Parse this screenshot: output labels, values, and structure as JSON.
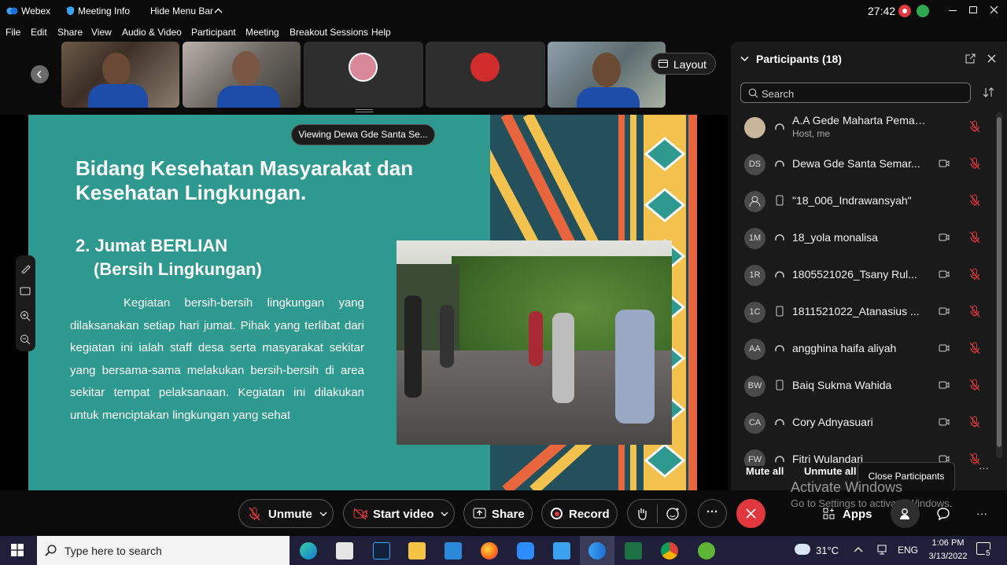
{
  "titlebar": {
    "app_name": "Webex",
    "meeting_info": "Meeting Info",
    "hide_menu": "Hide Menu Bar",
    "timer": "27:42"
  },
  "menu": [
    "File",
    "Edit",
    "Share",
    "View",
    "Audio & Video",
    "Participant",
    "Meeting",
    "Breakout Sessions",
    "Help"
  ],
  "layout_button": "Layout",
  "viewing_label": "Viewing Dewa Gde Santa Se...",
  "slide": {
    "title": "Bidang Kesehatan Masyarakat dan Kesehatan Lingkungan.",
    "subtitle_line1": "2. Jumat BERLIAN",
    "subtitle_line2": "(Bersih Lingkungan)",
    "body": "Kegiatan bersih-bersih lingkungan yang dilaksanakan setiap hari jumat. Pihak yang terlibat dari kegiatan ini ialah staff desa serta masyarakat sekitar yang bersama-sama melakukan bersih-bersih di area sekitar tempat pelaksanaan. Kegiatan ini dilakukan untuk menciptakan lingkungan yang sehat"
  },
  "participants": {
    "header": "Participants (18)",
    "search_placeholder": "Search",
    "list": [
      {
        "initials": "",
        "name": "A.A Gede Maharta Pemayun",
        "sub": "Host, me",
        "video": false
      },
      {
        "initials": "DS",
        "name": "Dewa Gde Santa Semar...",
        "sub": "",
        "video": true
      },
      {
        "initials": "",
        "name": "\"18_006_Indrawansyah\"",
        "sub": "",
        "video": false
      },
      {
        "initials": "1M",
        "name": "18_yola monalisa",
        "sub": "",
        "video": true
      },
      {
        "initials": "1R",
        "name": "1805521026_Tsany Rul...",
        "sub": "",
        "video": true
      },
      {
        "initials": "1C",
        "name": "1811521022_Atanasius ...",
        "sub": "",
        "video": true
      },
      {
        "initials": "AA",
        "name": "angghina haifa aliyah",
        "sub": "",
        "video": true
      },
      {
        "initials": "BW",
        "name": "Baiq Sukma Wahida",
        "sub": "",
        "video": true
      },
      {
        "initials": "CA",
        "name": "Cory Adnyasuari",
        "sub": "",
        "video": true
      },
      {
        "initials": "FW",
        "name": "Fitri Wulandari",
        "sub": "",
        "video": true
      }
    ],
    "mute_all": "Mute all",
    "unmute_all": "Unmute all",
    "close_tooltip": "Close Participants"
  },
  "controls": {
    "unmute": "Unmute",
    "start_video": "Start video",
    "share": "Share",
    "record": "Record",
    "apps": "Apps"
  },
  "watermark": {
    "line1": "Activate Windows",
    "line2": "Go to Settings to activate Windows."
  },
  "taskbar": {
    "search_placeholder": "Type here to search",
    "weather": "31°C",
    "lang": "ENG",
    "time": "1:06 PM",
    "date": "3/13/2022",
    "notif_count": "5"
  },
  "colors": {
    "slide_teal": "#2e9a8f",
    "end_red": "#e0383e",
    "accent_orange": "#e8663d",
    "accent_yellow": "#f2c14e"
  }
}
